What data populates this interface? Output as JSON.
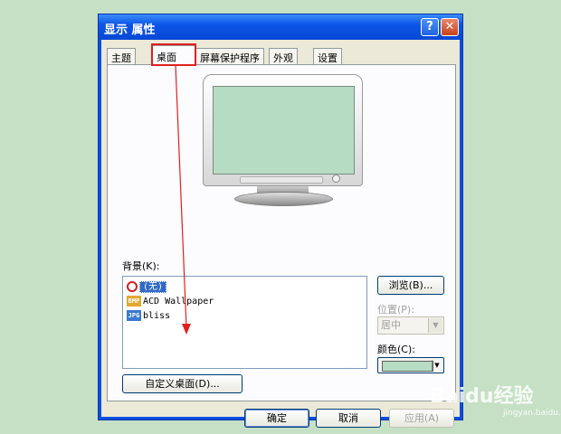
{
  "window": {
    "title": "显示 属性"
  },
  "titlebar": {
    "help_glyph": "?",
    "close_glyph": "✕"
  },
  "tabs": [
    {
      "label": "主题",
      "active": false
    },
    {
      "label": "桌面",
      "active": true
    },
    {
      "label": "屏幕保护程序",
      "active": false
    },
    {
      "label": "外观",
      "active": false
    },
    {
      "label": "设置",
      "active": false
    }
  ],
  "background": {
    "label": "背景(K):",
    "items": [
      {
        "label": "(无)",
        "icon": "none-icon",
        "selected": true
      },
      {
        "label": "ACD Wallpaper",
        "icon": "bmp-icon",
        "selected": false
      },
      {
        "label": "bliss",
        "icon": "jpg-icon",
        "selected": false
      }
    ]
  },
  "buttons": {
    "browse": "浏览(B)...",
    "customize": "自定义桌面(D)...",
    "ok": "确定",
    "cancel": "取消",
    "apply": "应用(A)"
  },
  "position": {
    "label": "位置(P):",
    "value": "居中"
  },
  "color": {
    "label": "颜色(C):",
    "value": "#b7dcc4"
  },
  "icon_glyphs": {
    "bmp": "BMP",
    "jpg": "JPG"
  },
  "watermark": {
    "brand": "Baidu经验",
    "url": "jingyan.baidu.com"
  },
  "colors": {
    "title_bar": "#0a4ee0",
    "highlight": "#e02020",
    "selection": "#316ac5",
    "desktop": "#c6e0c6"
  }
}
